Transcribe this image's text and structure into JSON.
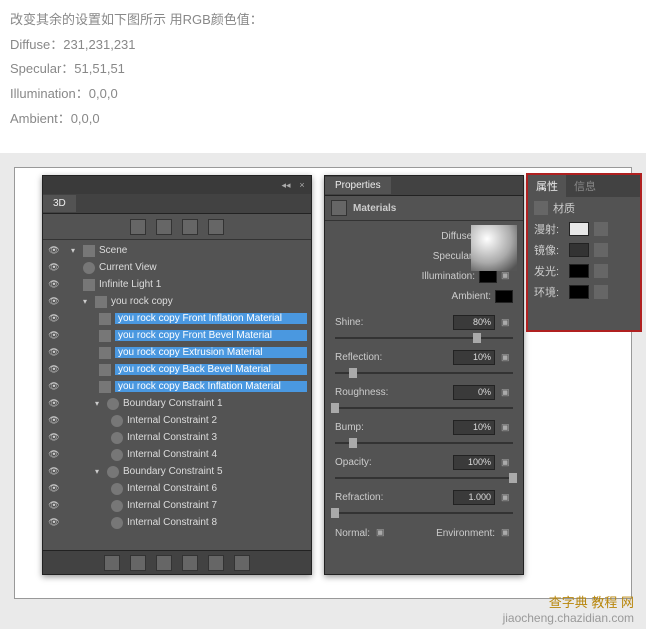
{
  "instructions": {
    "line1": "改变其余的设置如下图所示   用RGB颜色值：",
    "line2": "Diffuse：231,231,231",
    "line3": "Specular：51,51,51",
    "line4": "Illumination：0,0,0",
    "line5": "Ambient：0,0,0"
  },
  "panel3d": {
    "tab": "3D",
    "scene": "Scene",
    "currentView": "Current View",
    "light": "Infinite Light 1",
    "mesh": "you rock copy",
    "materials": [
      "you rock copy Front Inflation Material",
      "you rock copy Front Bevel Material",
      "you rock copy Extrusion Material",
      "you rock copy Back Bevel Material",
      "you rock copy Back Inflation Material"
    ],
    "boundary1": "Boundary Constraint 1",
    "internals1": [
      "Internal Constraint 2",
      "Internal Constraint 3",
      "Internal Constraint 4"
    ],
    "boundary5": "Boundary Constraint 5",
    "internals5": [
      "Internal Constraint 6",
      "Internal Constraint 7",
      "Internal Constraint 8"
    ]
  },
  "props": {
    "tab": "Properties",
    "title": "Materials",
    "channels": {
      "diffuse": "Diffuse:",
      "specular": "Specular:",
      "illumination": "Illumination:",
      "ambient": "Ambient:"
    },
    "colors": {
      "diffuse": "#e7e7e7",
      "specular": "#333333",
      "illumination": "#000000",
      "ambient": "#000000"
    },
    "sliders": [
      {
        "label": "Shine:",
        "value": "80%",
        "pos": 80
      },
      {
        "label": "Reflection:",
        "value": "10%",
        "pos": 10
      },
      {
        "label": "Roughness:",
        "value": "0%",
        "pos": 0
      },
      {
        "label": "Bump:",
        "value": "10%",
        "pos": 10
      },
      {
        "label": "Opacity:",
        "value": "100%",
        "pos": 100
      },
      {
        "label": "Refraction:",
        "value": "1.000",
        "pos": 0
      }
    ],
    "normal": "Normal:",
    "environment": "Environment:"
  },
  "cp": {
    "tab1": "属性",
    "tab2": "信息",
    "title": "材质",
    "rows": [
      {
        "label": "漫射:",
        "color": "#e7e7e7"
      },
      {
        "label": "镜像:",
        "color": "#333333"
      },
      {
        "label": "发光:",
        "color": "#000000"
      },
      {
        "label": "环境:",
        "color": "#000000"
      }
    ]
  },
  "watermark": {
    "cn": "查字典 教程 网",
    "url": "jiaocheng.chazidian.com"
  }
}
